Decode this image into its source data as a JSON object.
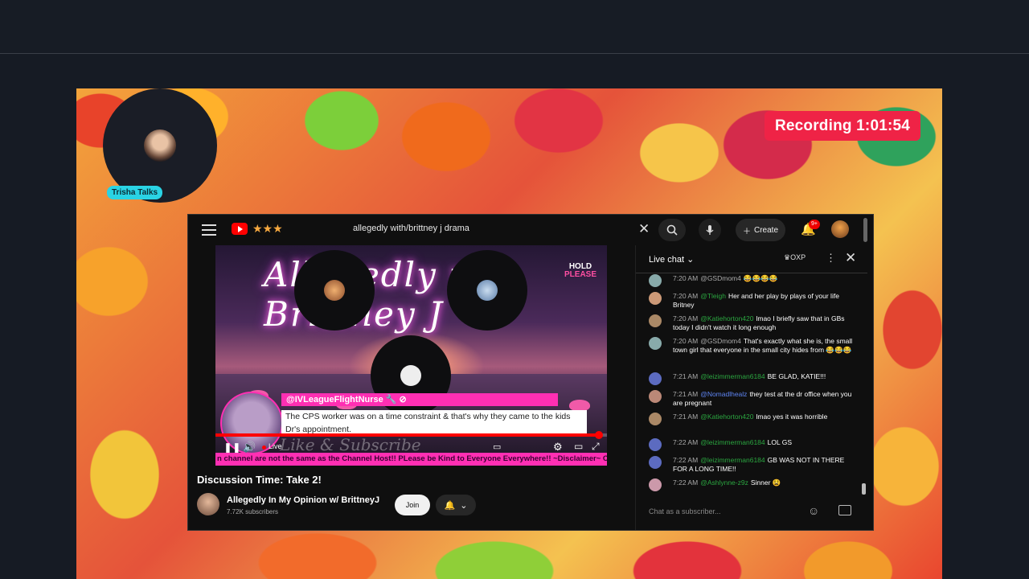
{
  "overlay": {
    "camera_label": "Trisha Talks",
    "recording": "Recording 1:01:54"
  },
  "youtube": {
    "search_query": "allegedly with/brittney j drama",
    "create_label": "Create",
    "notif_count": "9+",
    "video_title_art": "Allegedly w/ Brittney J",
    "hold_line1": "HOLD",
    "hold_line2": "PLEASE",
    "comment_user": "@IVLeagueFlightNurse 🔧 ⊘",
    "comment_text": "The CPS worker was on a time constraint & that's why they came to the kids Dr's appointment.",
    "overlay_watermark": "Like & Subscribe",
    "live_label": "Live",
    "ticker": "n channel are not the same as the Channel Host!! PLease be Kind to Everyone Everywhere!! ~Disclaimer~ Comments made",
    "progress": 0.98,
    "video_title": "Discussion Time: Take 2!",
    "channel_name": "Allegedly In My Opinion w/ BrittneyJ",
    "subscribers": "7.72K subscribers",
    "join_label": "Join",
    "chat": {
      "title": "Live chat",
      "oxp": "OXP",
      "input_placeholder": "Chat as a subscriber...",
      "messages": [
        {
          "time": "7:20 AM",
          "user": "@GSDmom4",
          "text": "😂😂😂😂",
          "color": "#8aa"
        },
        {
          "time": "7:20 AM",
          "user": "@Tleigh",
          "text": "Her and her play by plays of your life Britney",
          "color": "#c97"
        },
        {
          "time": "7:20 AM",
          "user": "@Katiehorton420",
          "text": "lmao I briefly saw that in GBs today I didn't watch it long enough",
          "color": "#a86"
        },
        {
          "time": "7:20 AM",
          "user": "@GSDmom4",
          "text": "That's exactly what she is, the small town girl that everyone in the small city hides from 😂😂😂",
          "color": "#8aa"
        },
        {
          "time": "7:21 AM",
          "user": "@leizimmerman6184",
          "text": "BE GLAD, KATIE!!!",
          "color": "#5c6bc0"
        },
        {
          "time": "7:21 AM",
          "user": "@Nomadlhealz",
          "text": "they test at the dr office when you are pregnant",
          "color": "#b87"
        },
        {
          "time": "7:21 AM",
          "user": "@Katiehorton420",
          "text": "lmao yes it was horrible",
          "color": "#a86"
        },
        {
          "time": "7:22 AM",
          "user": "@leizimmerman6184",
          "text": "LOL GS",
          "color": "#5c6bc0"
        },
        {
          "time": "7:22 AM",
          "user": "@leizimmerman6184",
          "text": "GB WAS NOT IN THERE FOR A LONG TIME!!",
          "color": "#5c6bc0"
        },
        {
          "time": "7:22 AM",
          "user": "@Ashlynne-z9z",
          "text": "Sinner 😫",
          "color": "#c9a"
        }
      ]
    }
  }
}
